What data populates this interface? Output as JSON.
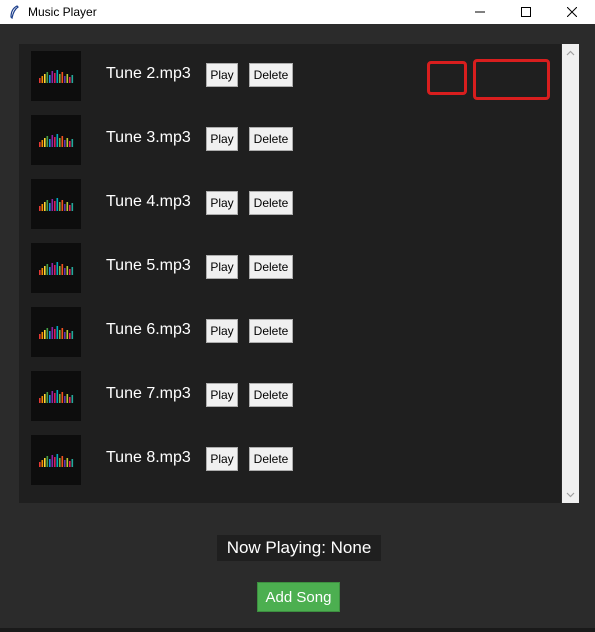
{
  "window": {
    "title": "Music Player",
    "controls": {
      "minimize": "—",
      "maximize": "☐",
      "close": "✕"
    }
  },
  "songs": [
    {
      "name": "Tune 2.mp3",
      "play_label": "Play",
      "delete_label": "Delete"
    },
    {
      "name": "Tune 3.mp3",
      "play_label": "Play",
      "delete_label": "Delete"
    },
    {
      "name": "Tune 4.mp3",
      "play_label": "Play",
      "delete_label": "Delete"
    },
    {
      "name": "Tune 5.mp3",
      "play_label": "Play",
      "delete_label": "Delete"
    },
    {
      "name": "Tune 6.mp3",
      "play_label": "Play",
      "delete_label": "Delete"
    },
    {
      "name": "Tune 7.mp3",
      "play_label": "Play",
      "delete_label": "Delete"
    },
    {
      "name": "Tune 8.mp3",
      "play_label": "Play",
      "delete_label": "Delete"
    }
  ],
  "status": {
    "now_playing": "Now Playing: None"
  },
  "actions": {
    "add_song_label": "Add Song"
  },
  "colors": {
    "background": "#2b2b2b",
    "panel": "#1f1f1f",
    "accent_green": "#4caf50",
    "annotation_red": "#d81e1e"
  },
  "icons": {
    "thumbnail": "equalizer-icon",
    "app": "feather-icon"
  }
}
